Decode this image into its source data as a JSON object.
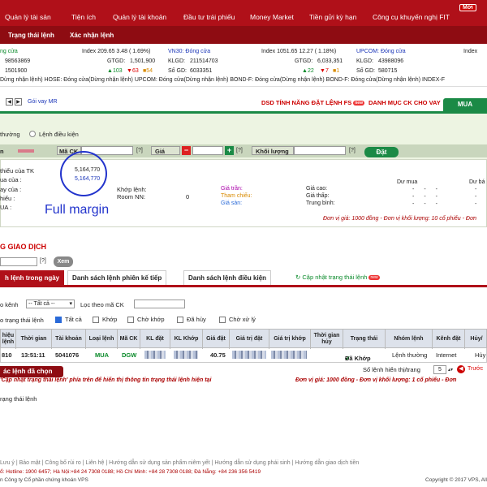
{
  "nav": {
    "items": [
      "Quản lý tài sản",
      "Tiện ích",
      "Quản lý tài khoản",
      "Đầu tư trái phiếu",
      "Money Market",
      "Tiền gửi kỳ hạn",
      "Công cụ khuyến nghị FIT"
    ],
    "badge": "Mới"
  },
  "subnav": {
    "items": [
      "Trạng thái lệnh",
      "Xác nhận lệnh"
    ]
  },
  "ticker": {
    "r1": {
      "c1": "ng cửa",
      "c2": "Index  209.65  3.48 ( 1.69%)",
      "c3": "VN30: Đóng cửa",
      "c4": "Index  1051.65  12.27 ( 1.18%)",
      "c5": "UPCOM: Đóng cửa",
      "c6": "Index"
    },
    "r2": {
      "c1": "98563869",
      "c2": "GTGD:",
      "c3": "1,501,900",
      "c4": "KLGD:",
      "c5": "211514703",
      "c6": "GTGD:",
      "c7": "6,033,351",
      "c8": "KLGD:",
      "c9": "43988096"
    },
    "r3": {
      "c1": "1501900",
      "u1": "103",
      "d1": "63",
      "n1": "54",
      "c2": "Số GD:",
      "c3": "6033351",
      "u2": "22",
      "d2": "7",
      "n2": "1",
      "c4": "Số GD:",
      "c5": "580715"
    }
  },
  "market_status": "Dừng nhận lệnh)   HOSE: Đóng cửa(Dừng nhận lệnh)   UPCOM: Đóng cửa(Dừng nhận lệnh)   BOND-F: Đóng cửa(Dừng nhận lệnh)   BOND-F: Đóng cửa(Dừng nhận lệnh)   INDEX-F",
  "toolbar": {
    "goivay": "Gói vay MR",
    "dsd": "DSD TÍNH NĂNG ĐẶT LỆNH FS",
    "danhmuc": "DANH MỤC CK CHO VAY",
    "mua": "MUA"
  },
  "order": {
    "ordtype1": "thường",
    "ordtype2": "Lệnh điều kiện",
    "ma_ck": "Mã CK",
    "gia": "Giá",
    "khoi_luong": "Khối lượng",
    "dat": "Đặt",
    "q": "[?]"
  },
  "info": {
    "lbl1": "thiểu của TK",
    "val1": "5,164,770",
    "lbl2": "ua của :",
    "val2": "5,164,770",
    "lbl3": "ay của :",
    "lbl4": "hiểu :",
    "lbl5": "UA :",
    "khop": "Khớp lệnh:",
    "room": "Room NN:",
    "room_val": "0",
    "gia_tran": "Giá trần:",
    "tham_chieu": "Tham chiếu:",
    "gia_san": "Giá sàn:",
    "gia_cao": "Giá cao:",
    "gia_thap": "Giá thấp:",
    "trung_binh": "Trung bình:",
    "du_mua": "Dư mua",
    "du_ban": "Dư bá",
    "unit": "Đơn vị giá: 1000 đồng - Đơn vị khối lượng: 10 cổ phiếu - Đơn"
  },
  "annotation": "Full margin",
  "list": {
    "title": "G GIAO DỊCH",
    "q": "[?]",
    "xem": "Xem",
    "tabs": [
      "h lệnh trong ngày",
      "Danh sách lệnh phiên kế tiếp",
      "Danh sách lệnh điều kiện"
    ],
    "update": "Cập nhật trạng thái lệnh",
    "san": "o kênh",
    "san_sel": "-- Tất cả --",
    "loc": "Lọc theo mã CK",
    "status_lbl": "o trạng thái lệnh",
    "cbs": [
      "Tất cả",
      "Khớp",
      "Chờ khớp",
      "Đã hủy",
      "Chờ xử lý"
    ],
    "headers": [
      "hiệu\nlệnh",
      "Thời gian",
      "Tài khoản",
      "Loại lệnh",
      "Mã CK",
      "KL đặt",
      "KL Khớp",
      "Giá đặt",
      "Giá trị đặt",
      "Giá trị khớp",
      "Thời gian\nhủy",
      "Trạng thái",
      "Nhóm lệnh",
      "Kênh đặt",
      "Hủy/"
    ],
    "row": {
      "id": "810",
      "time": "13:51:11",
      "acct": "5041076",
      "type": "MUA",
      "ma": "DGW",
      "price": "40.75",
      "status": "Đã Khớp",
      "group": "Lệnh thường",
      "channel": "Internet",
      "act": "Hủy"
    },
    "cancel": "ác lệnh đã chọn",
    "perpage_lbl": "Số lệnh hiển thị/trang",
    "perpage": "5",
    "prev": "Trước",
    "note": "'Cập nhật trạng thái lệnh' phía trên để hiển thị thông tin trạng thái lệnh hiện tại",
    "note2": "Đơn vị giá: 1000 đồng - Đơn vị khối lượng: 1 cổ phiếu - Đơn",
    "trangthai": "rạng thái lệnh"
  },
  "footer": {
    "links": "Lưu ý  |  Bảo mật  |  Công bố rủi ro  |  Liên hệ  |  Hướng dẫn sử dụng sản phẩm niêm yết  |  Hướng dẫn sử dụng phái sinh  |  Hướng dẫn giao dịch tiền",
    "contact": "ổ: Hotline: 1900 6457; Hà Nội:+84 24 7308 0188; Hồ Chí Minh: +84 28 7308 0188; Đà Nẵng: +84 236 356 5419",
    "company": "n Công ty Cổ phần chứng khoán VPS",
    "copyright": "Copyright © 2017 VPS, All"
  }
}
